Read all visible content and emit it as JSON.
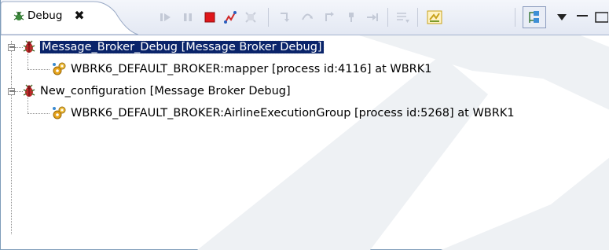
{
  "view": {
    "tab_label": "Debug",
    "tab_close_glyph": "✖",
    "tab_icon": "bug-icon"
  },
  "toolbar": {
    "icons": [
      "resume-icon",
      "suspend-icon",
      "terminate-icon",
      "disconnect-icon",
      "remove-terminated-icon",
      "step-into-icon",
      "step-over-icon",
      "step-return-icon",
      "drop-to-frame-icon",
      "run-to-line-icon",
      "use-step-filters-icon",
      "flow-debug-icon",
      "show-qualified-names-icon",
      "view-menu-icon",
      "minimize-icon"
    ]
  },
  "tree": {
    "items": [
      {
        "label": "Message_Broker_Debug [Message Broker Debug]",
        "expander": "−",
        "icon": "debug-launch-icon",
        "selected": true,
        "children": [
          {
            "label": "WBRK6_DEFAULT_BROKER:mapper [process id:4116] at  WBRK1",
            "icon": "broker-gears-icon"
          }
        ]
      },
      {
        "label": "New_configuration [Message Broker Debug]",
        "expander": "−",
        "icon": "debug-launch-icon",
        "selected": false,
        "children": [
          {
            "label": "WBRK6_DEFAULT_BROKER:AirlineExecutionGroup [process id:5268] at  WBRK1",
            "icon": "broker-gears-icon"
          }
        ]
      }
    ]
  },
  "colors": {
    "selection": "#0a246a",
    "watermark": "#eef1f4"
  }
}
